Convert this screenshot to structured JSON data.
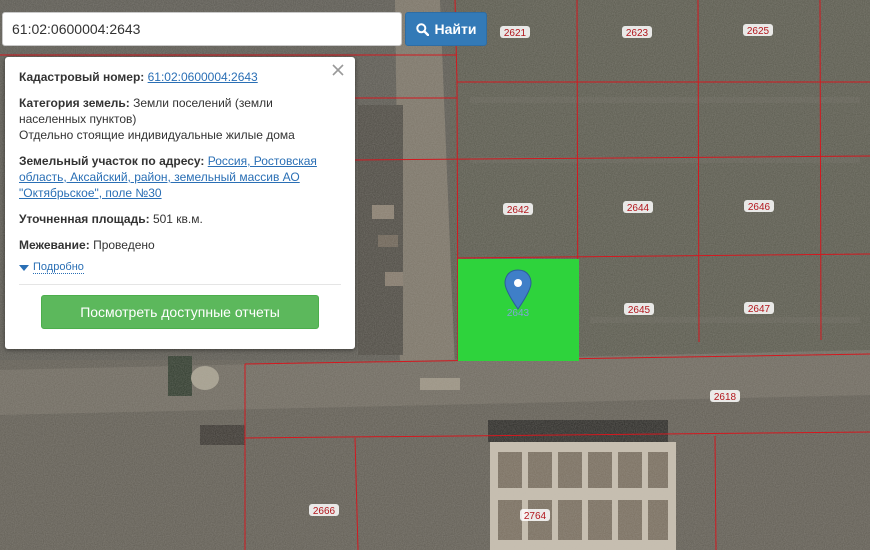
{
  "search": {
    "value": "61:02:0600004:2643",
    "button_label": "Найти"
  },
  "popup": {
    "cadastral_label": "Кадастровый номер:",
    "cadastral_number": "61:02:0600004:2643",
    "land_category_label": "Категория земель:",
    "land_category_value": "Земли поселений (земли населенных пунктов)",
    "permitted_use": "Отдельно стоящие индивидуальные жилые дома",
    "address_label": "Земельный участок по адресу:",
    "address_value": "Россия, Ростовская область, Аксайский, район, земельный массив АО \"Октябрьское\", поле №30",
    "area_label": "Уточненная площадь:",
    "area_value": "501 кв.м.",
    "survey_label": "Межевание:",
    "survey_value": "Проведено",
    "more_link": "Подробно",
    "report_button": "Посмотреть доступные отчеты"
  },
  "map": {
    "parcel_labels": [
      "2621",
      "2623",
      "2625",
      "2642",
      "2644",
      "2646",
      "2643",
      "2645",
      "2647",
      "2618",
      "2666",
      "2764"
    ],
    "selected_parcel": "2643",
    "colors": {
      "boundary": "#d4181f",
      "selected_fill": "#2ed33c",
      "marker": "#3f7fc8",
      "label_text": "#b2161c"
    }
  }
}
